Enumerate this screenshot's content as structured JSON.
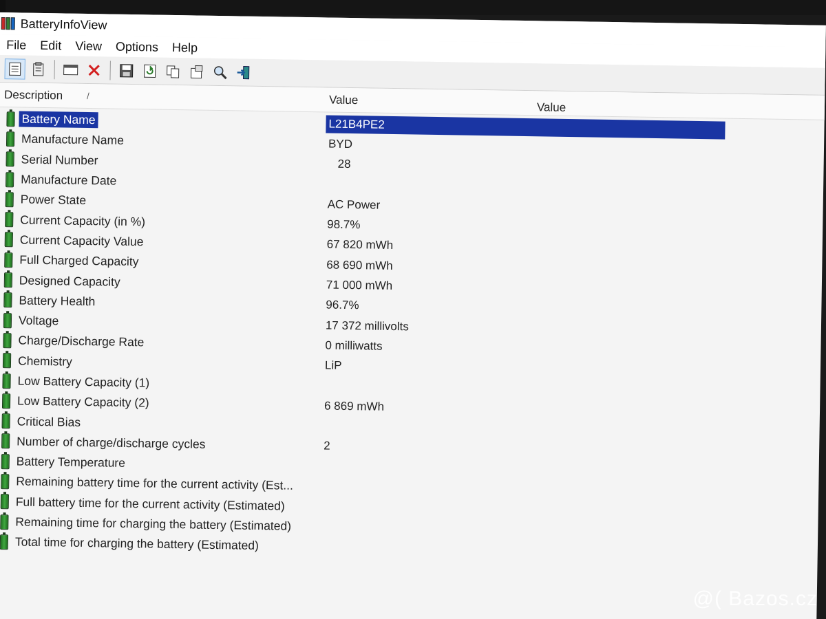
{
  "window": {
    "title": "BatteryInfoView"
  },
  "menu": [
    "File",
    "Edit",
    "View",
    "Options",
    "Help"
  ],
  "toolbar": {
    "buttons": [
      {
        "name": "details-view-icon"
      },
      {
        "name": "report-view-icon"
      },
      {
        "name": "html-report-icon"
      },
      {
        "name": "delete-icon"
      },
      {
        "name": "save-icon"
      },
      {
        "name": "refresh-icon"
      },
      {
        "name": "copy-icon"
      },
      {
        "name": "properties-icon"
      },
      {
        "name": "find-icon"
      },
      {
        "name": "exit-icon"
      }
    ]
  },
  "columns": {
    "description": "Description",
    "value": "Value",
    "value2": "Value"
  },
  "rows": [
    {
      "desc": "Battery Name",
      "value": "L21B4PE2"
    },
    {
      "desc": "Manufacture Name",
      "value": "BYD"
    },
    {
      "desc": "Serial Number",
      "value": "28"
    },
    {
      "desc": "Manufacture Date",
      "value": ""
    },
    {
      "desc": "Power State",
      "value": "AC Power"
    },
    {
      "desc": "Current Capacity (in %)",
      "value": "98.7%"
    },
    {
      "desc": "Current Capacity Value",
      "value": "67 820 mWh"
    },
    {
      "desc": "Full Charged Capacity",
      "value": "68 690 mWh"
    },
    {
      "desc": "Designed Capacity",
      "value": "71 000 mWh"
    },
    {
      "desc": "Battery Health",
      "value": "96.7%"
    },
    {
      "desc": "Voltage",
      "value": "17 372 millivolts"
    },
    {
      "desc": "Charge/Discharge Rate",
      "value": "0 milliwatts"
    },
    {
      "desc": "Chemistry",
      "value": "LiP"
    },
    {
      "desc": "Low Battery Capacity (1)",
      "value": ""
    },
    {
      "desc": "Low Battery Capacity (2)",
      "value": "6 869 mWh"
    },
    {
      "desc": "Critical Bias",
      "value": ""
    },
    {
      "desc": "Number of charge/discharge cycles",
      "value": "2"
    },
    {
      "desc": "Battery Temperature",
      "value": ""
    },
    {
      "desc": "Remaining battery time for the current activity (Est...",
      "value": ""
    },
    {
      "desc": "Full battery time for the current activity (Estimated)",
      "value": ""
    },
    {
      "desc": "Remaining time for charging the battery (Estimated)",
      "value": ""
    },
    {
      "desc": "Total  time for charging the battery (Estimated)",
      "value": ""
    }
  ],
  "selected_row": "Battery Name",
  "watermark": "@( Bazos.cz"
}
